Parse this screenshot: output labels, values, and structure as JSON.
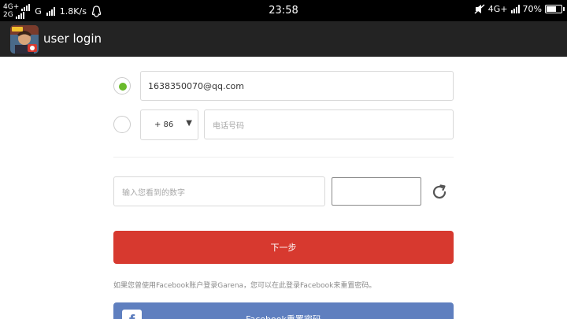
{
  "status_bar": {
    "network_top": "4G+",
    "network_bottom": "2G",
    "network_mid": "G",
    "speed": "1.8K/s",
    "time": "23:58",
    "network_right": "4G+",
    "battery": "70%",
    "battery_level": 0.7
  },
  "app_bar": {
    "title": "user login",
    "icon": "game-app-icon"
  },
  "form": {
    "email_value": "1638350070@qq.com",
    "country_code": "+ 86",
    "phone_placeholder": "电话号码",
    "captcha_placeholder": "输入您看到的数字",
    "next_label": "下一步",
    "hint": "如果您曾使用Facebook账户登录Garena，您可以在此登录Facebook来重置密码。",
    "facebook_label": "Facebook重置密码"
  },
  "colors": {
    "accent_red": "#d7392f",
    "radio_green": "#6aba2b",
    "facebook_blue": "#5f7fbf",
    "app_bar": "#232323"
  }
}
